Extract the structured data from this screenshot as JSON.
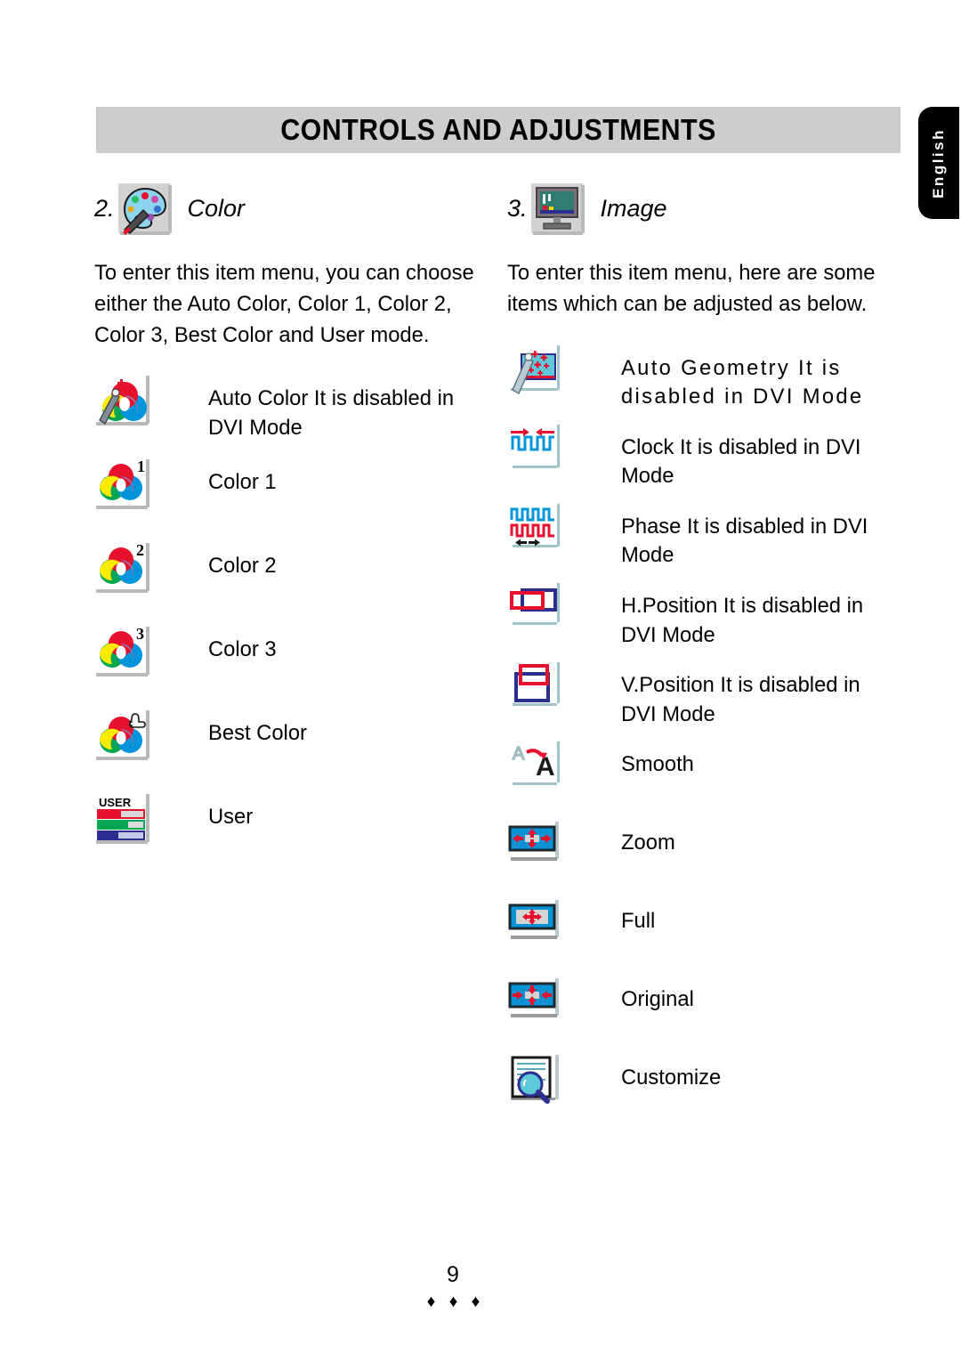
{
  "header": {
    "title": "CONTROLS AND ADJUSTMENTS"
  },
  "language_tab": {
    "label": "English"
  },
  "left_column": {
    "section": {
      "number": "2.",
      "title": "Color",
      "icon": "color-palette-icon"
    },
    "intro": "To enter this item menu, you can choose either the Auto Color, Color 1, Color 2, Color 3, Best Color and User mode.",
    "items": [
      {
        "icon": "auto-color-icon",
        "label": "Auto Color   It is disabled in DVI Mode"
      },
      {
        "icon": "color-1-icon",
        "label": "Color 1"
      },
      {
        "icon": "color-2-icon",
        "label": "Color 2"
      },
      {
        "icon": "color-3-icon",
        "label": "Color 3"
      },
      {
        "icon": "best-color-icon",
        "label": "Best Color"
      },
      {
        "icon": "user-color-icon",
        "label": "User"
      }
    ]
  },
  "right_column": {
    "section": {
      "number": "3.",
      "title": "Image",
      "icon": "monitor-icon"
    },
    "intro": "To enter this item menu, here are some items which can be adjusted as below.",
    "items": [
      {
        "icon": "auto-geometry-icon",
        "label": "Auto Geometry  It is disabled in DVI Mode",
        "spaced": true
      },
      {
        "icon": "clock-icon",
        "label": "Clock   It is disabled in DVI Mode"
      },
      {
        "icon": "phase-icon",
        "label": "Phase   It is disabled in DVI Mode"
      },
      {
        "icon": "h-position-icon",
        "label": "H.Position   It is disabled in DVI Mode"
      },
      {
        "icon": "v-position-icon",
        "label": "V.Position   It is disabled in DVI Mode"
      },
      {
        "icon": "smooth-icon",
        "label": "Smooth"
      },
      {
        "icon": "zoom-icon",
        "label": "Zoom"
      },
      {
        "icon": "full-icon",
        "label": "Full"
      },
      {
        "icon": "original-icon",
        "label": "Original"
      },
      {
        "icon": "customize-icon",
        "label": "Customize"
      }
    ]
  },
  "footer": {
    "page_number": "9",
    "ornament": "♦ ♦ ♦"
  },
  "colors": {
    "header_bar": "#cdcdcd",
    "tab_background": "#000000",
    "tab_text": "#ffffff",
    "icon_red": "#e8112d",
    "icon_green": "#00a651",
    "icon_blue": "#0095da",
    "icon_yellow": "#ffeb00",
    "icon_purple": "#9b6fa8",
    "icon_navy": "#2b2e8f",
    "icon_cyan": "#5ec8d8"
  }
}
